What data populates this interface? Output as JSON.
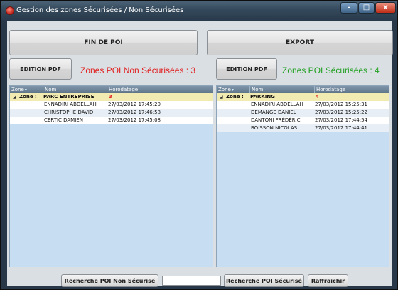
{
  "window": {
    "title": "Gestion des zones Sécurisées / Non Sécurisées",
    "controls": {
      "minimize": "–",
      "maximize": "□",
      "close": "x"
    }
  },
  "toolbar": {
    "fin_de_poi": "FIN DE POI",
    "export": "EXPORT"
  },
  "left": {
    "edition_pdf": "EDITION PDF",
    "label": "Zones POI Non Sécurisées : 3",
    "label_color": "#e02020",
    "columns": [
      "Zone",
      "Nom",
      "Horodatage"
    ],
    "group": {
      "prefix": "Zone :",
      "name": "PARC ENTREPRISE",
      "count": "3"
    },
    "rows": [
      {
        "nom": "ENNADIRI ABDELLAH",
        "horodatage": "27/03/2012 17:45:20"
      },
      {
        "nom": "CHRISTOPHE DAVID",
        "horodatage": "27/03/2012 17:46:58"
      },
      {
        "nom": "CERTIC DAMIEN",
        "horodatage": "27/03/2012 17:45:08"
      }
    ]
  },
  "right": {
    "edition_pdf": "EDITION PDF",
    "label": "Zones POI Sécurisées : 4",
    "label_color": "#22a022",
    "columns": [
      "Zone",
      "Nom",
      "Horodatage"
    ],
    "group": {
      "prefix": "Zone :",
      "name": "PARKING",
      "count": "4"
    },
    "rows": [
      {
        "nom": "ENNADIRI ABDELLAH",
        "horodatage": "27/03/2012 15:25:31"
      },
      {
        "nom": "DEMANGE DANIEL",
        "horodatage": "27/03/2012 15:25:22"
      },
      {
        "nom": "DANTONI FRÉDÉRIC",
        "horodatage": "27/03/2012 17:44:54"
      },
      {
        "nom": "BOISSON NICOLAS",
        "horodatage": "27/03/2012 17:44:41"
      }
    ]
  },
  "footer": {
    "search_non_secure": "Recherche POI Non Sécurisé",
    "search_value": "",
    "search_secure": "Recherche POI Sécurisé",
    "refresh": "Raffraichir"
  }
}
